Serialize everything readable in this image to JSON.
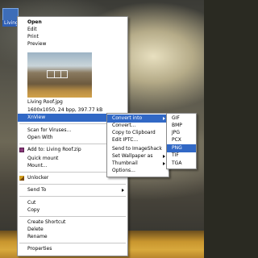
{
  "desktop": {
    "file_label": "Living"
  },
  "context_menu": {
    "items": [
      {
        "label": "Open"
      },
      {
        "label": "Edit"
      },
      {
        "label": "Print"
      },
      {
        "label": "Preview"
      },
      {
        "label": "Living Roof.jpg"
      },
      {
        "label": "1600x1050, 24 bpp, 397.77 kB"
      },
      {
        "label": "XnView"
      },
      {
        "label": "Scan for Viruses..."
      },
      {
        "label": "Open With"
      },
      {
        "label": "Add to: Living Roof.zip"
      },
      {
        "label": "Quick mount"
      },
      {
        "label": "Mount..."
      },
      {
        "label": "Unlocker"
      },
      {
        "label": "Send To"
      },
      {
        "label": "Cut"
      },
      {
        "label": "Copy"
      },
      {
        "label": "Create Shortcut"
      },
      {
        "label": "Delete"
      },
      {
        "label": "Rename"
      },
      {
        "label": "Properties"
      }
    ]
  },
  "xnview_submenu": {
    "items": [
      {
        "label": "Convert into"
      },
      {
        "label": "Convert..."
      },
      {
        "label": "Copy to Clipboard"
      },
      {
        "label": "Edit IPTC..."
      },
      {
        "label": "Send to ImageShack"
      },
      {
        "label": "Set Wallpaper as"
      },
      {
        "label": "Thumbnail"
      },
      {
        "label": "Options..."
      }
    ]
  },
  "convert_submenu": {
    "items": [
      {
        "label": "GIF"
      },
      {
        "label": "BMP"
      },
      {
        "label": "JPG"
      },
      {
        "label": "PCX"
      },
      {
        "label": "PNG"
      },
      {
        "label": "TIF"
      },
      {
        "label": "TGA"
      }
    ]
  },
  "colors": {
    "highlight": "#3168c5"
  }
}
